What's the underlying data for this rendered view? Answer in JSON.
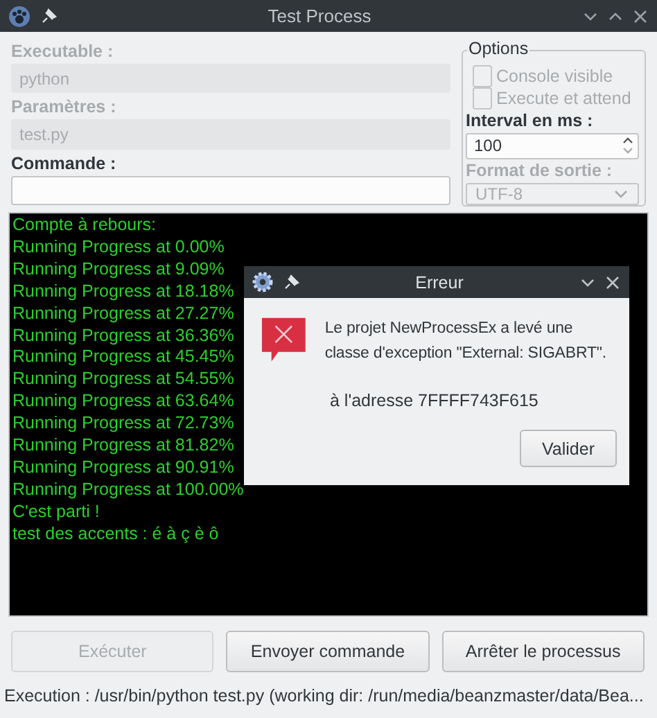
{
  "window": {
    "title": "Test Process"
  },
  "fields": [
    {
      "label": "Executable :",
      "value": "python",
      "disabled": true
    },
    {
      "label": "Paramètres :",
      "value": "test.py",
      "disabled": true
    },
    {
      "label": "Commande :",
      "disabled": false
    }
  ],
  "options": {
    "title": "Options",
    "checkboxes": [
      {
        "label": "Console visible",
        "checked": false,
        "disabled": true
      },
      {
        "label": "Execute et attend",
        "checked": false,
        "disabled": true
      }
    ],
    "interval": {
      "label": "Interval  en ms :",
      "value": "100"
    },
    "format": {
      "label": "Format de sortie :",
      "value": "UTF-8",
      "disabled": true
    }
  },
  "console": {
    "lines": [
      "Compte à rebours:",
      "Running Progress at 0.00%",
      "Running Progress at 9.09%",
      "Running Progress at 18.18%",
      "Running Progress at 27.27%",
      "Running Progress at 36.36%",
      "Running Progress at 45.45%",
      "Running Progress at 54.55%",
      "Running Progress at 63.64%",
      "Running Progress at 72.73%",
      "Running Progress at 81.82%",
      "Running Progress at 90.91%",
      "Running Progress at 100.00%",
      "C'est parti !",
      "test des accents : é à ç è ô"
    ]
  },
  "dialog": {
    "title": "Erreur",
    "message": "Le projet NewProcessEx a levé une classe d'exception \"External: SIGABRT\".",
    "address": "à l'adresse 7FFFF743F615",
    "button": "Valider"
  },
  "buttons": [
    {
      "label": "Exécuter",
      "disabled": true
    },
    {
      "label": "Envoyer commande",
      "disabled": false
    },
    {
      "label": "Arrêter le processus",
      "disabled": false
    }
  ],
  "status_bar": "Execution : /usr/bin/python test.py (working dir: /run/media/beanzmaster/data/Bea..."
}
